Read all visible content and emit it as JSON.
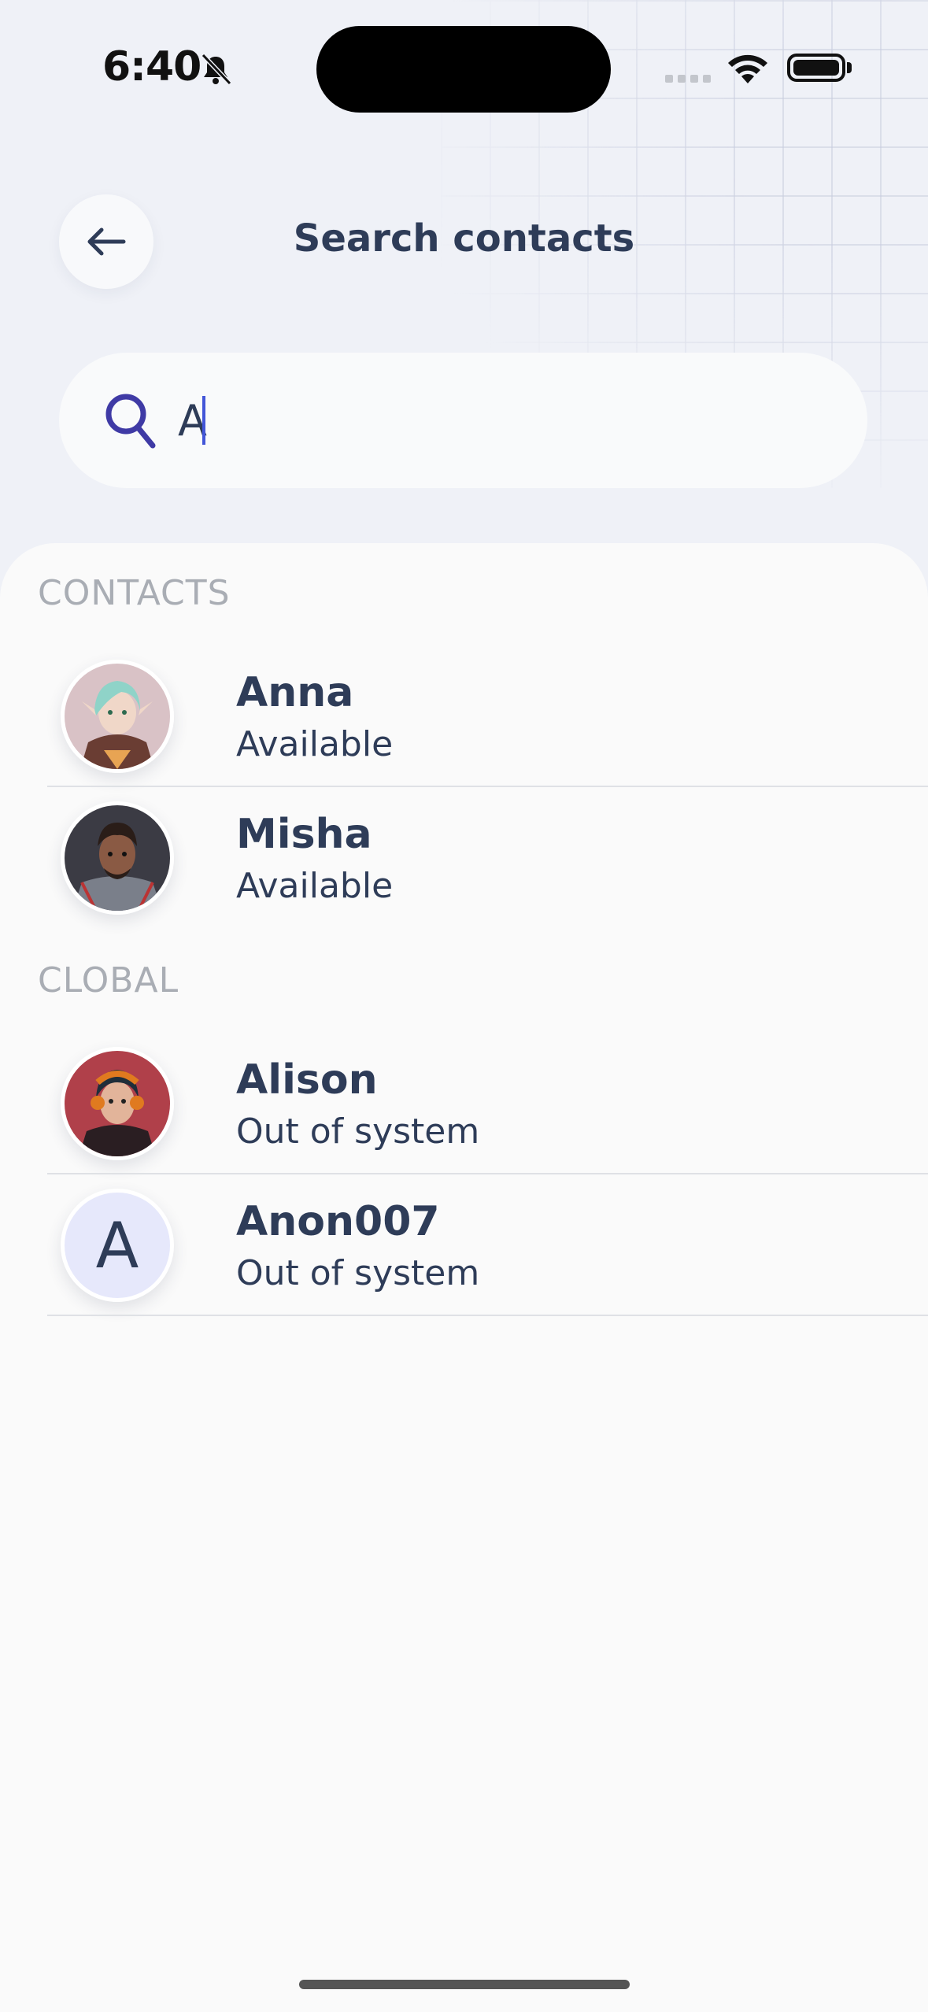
{
  "status_bar": {
    "time": "6:40"
  },
  "header": {
    "title": "Search contacts"
  },
  "search": {
    "value": "A"
  },
  "sections": {
    "contacts_label": "CONTACTS",
    "global_label": "CLOBAL"
  },
  "contacts": [
    {
      "name": "Anna",
      "status": "Available"
    },
    {
      "name": "Misha",
      "status": "Available"
    }
  ],
  "global": [
    {
      "name": "Alison",
      "status": "Out of system"
    },
    {
      "name": "Anon007",
      "status": "Out of system",
      "initial": "A"
    }
  ],
  "colors": {
    "accent": "#4356d8",
    "text": "#2e3c58",
    "muted": "#a9adb4",
    "sheet": "#fafafa",
    "bg": "#eff1f7"
  }
}
